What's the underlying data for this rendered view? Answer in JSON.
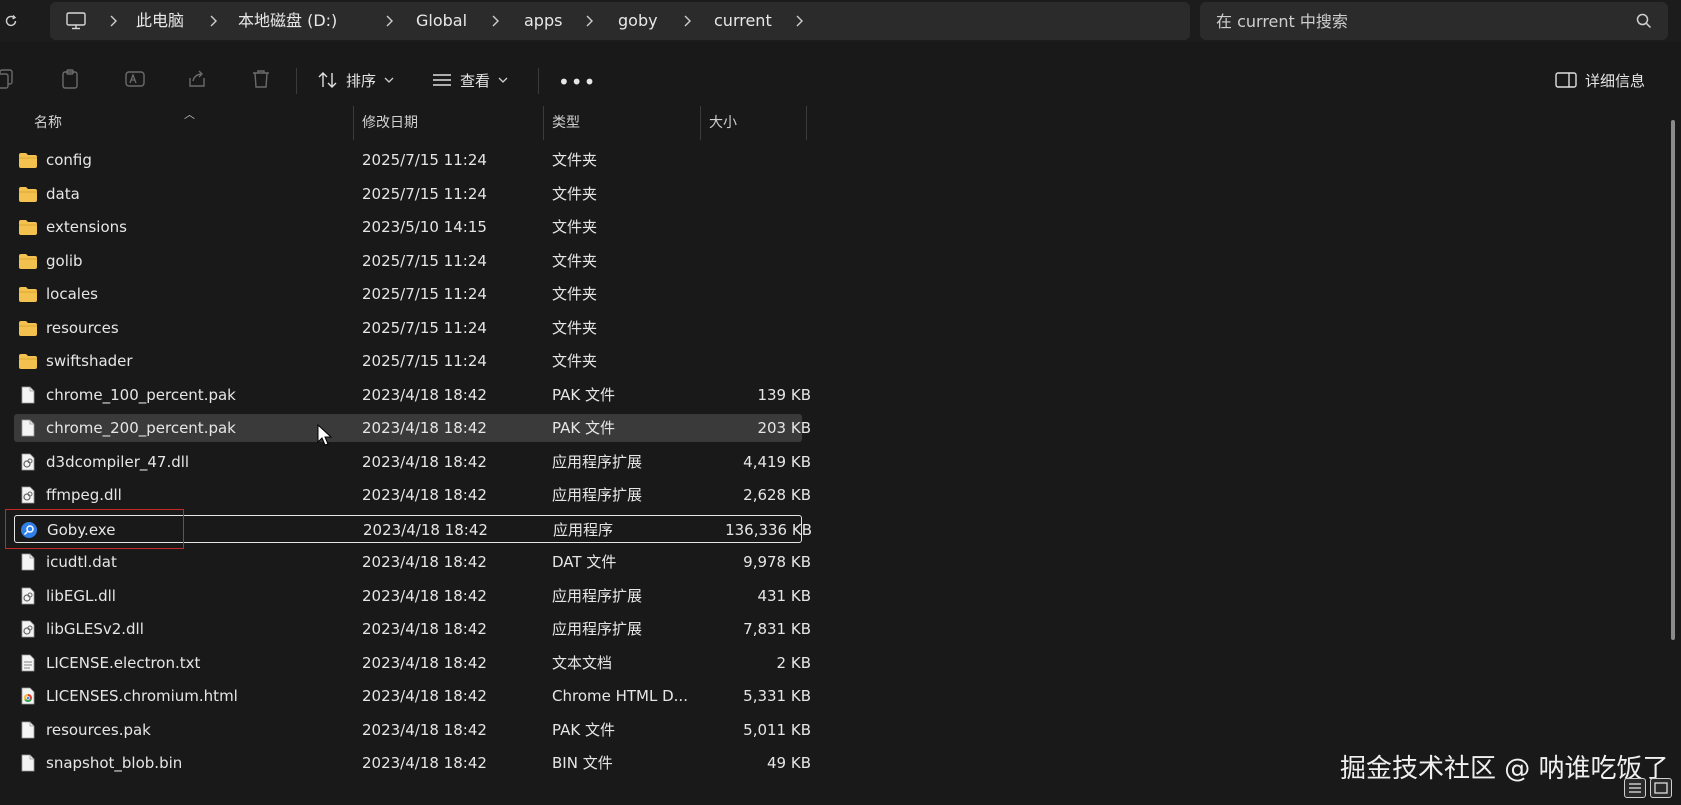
{
  "address_bar": {
    "crumbs": [
      "此电脑",
      "本地磁盘 (D:)",
      "Global",
      "apps",
      "goby",
      "current"
    ]
  },
  "search": {
    "placeholder": "在 current 中搜索"
  },
  "command_bar": {
    "sort_label": "排序",
    "view_label": "查看",
    "more_label": "•••",
    "details_label": "详细信息"
  },
  "columns": {
    "name": "名称",
    "date": "修改日期",
    "type": "类型",
    "size": "大小"
  },
  "files": [
    {
      "name": "config",
      "date": "2025/7/15 11:24",
      "type": "文件夹",
      "size": "",
      "icon": "folder-icon"
    },
    {
      "name": "data",
      "date": "2025/7/15 11:24",
      "type": "文件夹",
      "size": "",
      "icon": "folder-icon"
    },
    {
      "name": "extensions",
      "date": "2023/5/10 14:15",
      "type": "文件夹",
      "size": "",
      "icon": "folder-icon"
    },
    {
      "name": "golib",
      "date": "2025/7/15 11:24",
      "type": "文件夹",
      "size": "",
      "icon": "folder-icon"
    },
    {
      "name": "locales",
      "date": "2025/7/15 11:24",
      "type": "文件夹",
      "size": "",
      "icon": "folder-icon"
    },
    {
      "name": "resources",
      "date": "2025/7/15 11:24",
      "type": "文件夹",
      "size": "",
      "icon": "folder-icon"
    },
    {
      "name": "swiftshader",
      "date": "2025/7/15 11:24",
      "type": "文件夹",
      "size": "",
      "icon": "folder-icon"
    },
    {
      "name": "chrome_100_percent.pak",
      "date": "2023/4/18 18:42",
      "type": "PAK 文件",
      "size": "139 KB",
      "icon": "file-icon"
    },
    {
      "name": "chrome_200_percent.pak",
      "date": "2023/4/18 18:42",
      "type": "PAK 文件",
      "size": "203 KB",
      "icon": "file-icon"
    },
    {
      "name": "d3dcompiler_47.dll",
      "date": "2023/4/18 18:42",
      "type": "应用程序扩展",
      "size": "4,419 KB",
      "icon": "dll-icon"
    },
    {
      "name": "ffmpeg.dll",
      "date": "2023/4/18 18:42",
      "type": "应用程序扩展",
      "size": "2,628 KB",
      "icon": "dll-icon"
    },
    {
      "name": "Goby.exe",
      "date": "2023/4/18 18:42",
      "type": "应用程序",
      "size": "136,336 KB",
      "icon": "goby-app-icon"
    },
    {
      "name": "icudtl.dat",
      "date": "2023/4/18 18:42",
      "type": "DAT 文件",
      "size": "9,978 KB",
      "icon": "file-icon"
    },
    {
      "name": "libEGL.dll",
      "date": "2023/4/18 18:42",
      "type": "应用程序扩展",
      "size": "431 KB",
      "icon": "dll-icon"
    },
    {
      "name": "libGLESv2.dll",
      "date": "2023/4/18 18:42",
      "type": "应用程序扩展",
      "size": "7,831 KB",
      "icon": "dll-icon"
    },
    {
      "name": "LICENSE.electron.txt",
      "date": "2023/4/18 18:42",
      "type": "文本文档",
      "size": "2 KB",
      "icon": "text-file-icon"
    },
    {
      "name": "LICENSES.chromium.html",
      "date": "2023/4/18 18:42",
      "type": "Chrome HTML D...",
      "size": "5,331 KB",
      "icon": "chrome-html-icon"
    },
    {
      "name": "resources.pak",
      "date": "2023/4/18 18:42",
      "type": "PAK 文件",
      "size": "5,011 KB",
      "icon": "file-icon"
    },
    {
      "name": "snapshot_blob.bin",
      "date": "2023/4/18 18:42",
      "type": "BIN 文件",
      "size": "49 KB",
      "icon": "file-icon"
    }
  ],
  "hover_row_index": 8,
  "selected_row_index": 11,
  "watermark": "掘金技术社区 @ 呐谁吃饭了",
  "colors": {
    "background": "#191919",
    "folder": "#f2c14e",
    "selection_highlight": "#c62828",
    "goby_icon": "#2f7fe8"
  }
}
